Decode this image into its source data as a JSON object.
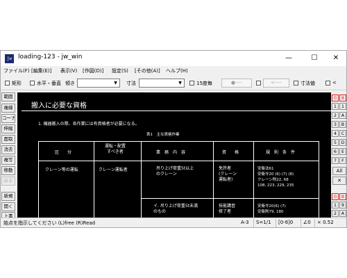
{
  "window": {
    "title": "loading-123 - jw_win",
    "app_icon_text": "jw",
    "minimize": "—",
    "maximize": "☐",
    "close": "✕"
  },
  "menu": [
    "ファイル(F)",
    "[編集(E)]",
    "表示(V)",
    "[作図(D)]",
    "設定(S)",
    "[その他(A)]",
    "ヘルプ(H)"
  ],
  "toolbar": {
    "rect_label": "矩形",
    "hv_label": "水平・垂直",
    "tilt_label": "傾き",
    "dim_label": "寸法",
    "fifteen_label": "15度毎",
    "btn1": "●----",
    "btn2": "<----",
    "dimval_label": "寸法値",
    "lt_label": "<"
  },
  "left_tools": [
    "範囲",
    "複線",
    "コーナー",
    "伸縮",
    "面取",
    "消去",
    "複写",
    "移動",
    "戻る",
    "新規",
    "開く",
    "上書"
  ],
  "right_tools": {
    "top": [
      [
        "0",
        "8"
      ],
      [
        "1",
        "1"
      ],
      [
        "2",
        "A"
      ],
      [
        "3",
        "B"
      ],
      [
        "4",
        "C"
      ],
      [
        "5",
        "D"
      ],
      [
        "6",
        "E"
      ],
      [
        "7",
        "F"
      ]
    ],
    "all": "All",
    "cross": "✕",
    "bottom": [
      [
        "0",
        "8"
      ],
      [
        "1",
        "9"
      ],
      [
        "2",
        "A"
      ]
    ]
  },
  "document": {
    "title": "搬入に必要な資格",
    "note": "1. 機器搬入の際、各作業には有資格者が必要になる。",
    "table_caption": "表1　主な資格作業",
    "headers": [
      "区　　分",
      "運転・配置\nすべき者",
      "業　務　内　容",
      "資　　格",
      "規　則　条　件"
    ],
    "rows": [
      [
        "クレーン等の運転",
        "クレーン運転者",
        "吊り上げ荷重5t以上\nのクレーン",
        "免許者\n(クレーン\n運転者)",
        "安衛法61\n安衛令20 (6) (7) (8)\nクレーン則22, 68\n108, 223, 229, 235"
      ],
      [
        "",
        "",
        "イ. 吊り上げ荷重5t未満\nのもの",
        "技能講習\n修了者",
        "安衛令20(6) (7)\n安衛則79, 180"
      ]
    ]
  },
  "status": {
    "prompt": "始点を指示してください (L)free (R)Read",
    "paper": "A-3",
    "scale": "S=1/1",
    "layer": "[0-6]0",
    "angle": "∠0",
    "zoom": "× 0.52"
  }
}
